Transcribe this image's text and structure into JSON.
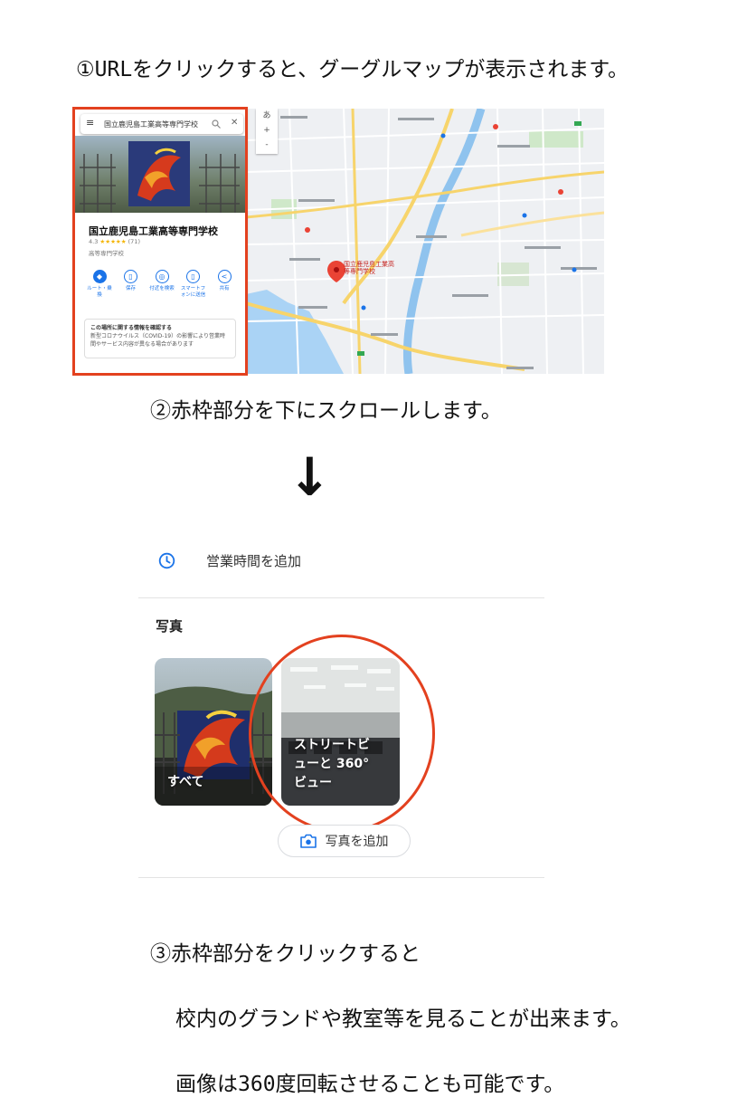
{
  "steps": {
    "step1": "①URLをクリックすると、グーグルマップが表示されます。",
    "step2": "②赤枠部分を下にスクロールします。",
    "arrow": "↓",
    "step3_line1": "③赤枠部分をクリックすると",
    "step3_line2": "校内のグランドや教室等を見ることが出来ます。",
    "step3_line3": "画像は360度回転させることも可能です。"
  },
  "map_screenshot": {
    "search_value": "国立鹿児島工業高等専門学校",
    "place_name": "国立鹿児島工業高等専門学校",
    "rating": "4.3",
    "stars": "★★★★★",
    "review_count": "(71)",
    "category": "高等専門学校",
    "actions": [
      "ルート・乗換",
      "保存",
      "付近を検索",
      "スマートフォンに送信",
      "共有"
    ],
    "notice_title": "この場所に関する情報を確認する",
    "notice_body": "新型コロナウイルス（COVID-19）の影響により営業時間やサービス内容が異なる場合があります",
    "marker_label": "国立鹿児島工業高等専門学校",
    "zoom_labels": [
      "あ",
      "+",
      "-"
    ]
  },
  "panel_screenshot": {
    "hours_label": "営業時間を追加",
    "photos_heading": "写真",
    "tile_all": "すべて",
    "tile_street_line1": "ストリートビ",
    "tile_street_line2": "ューと 360°",
    "tile_street_line3": "ビュー",
    "add_photo_label": "写真を追加"
  },
  "colors": {
    "highlight_red": "#e3411f",
    "google_blue": "#1a73e8",
    "marker_red": "#ea4335"
  }
}
